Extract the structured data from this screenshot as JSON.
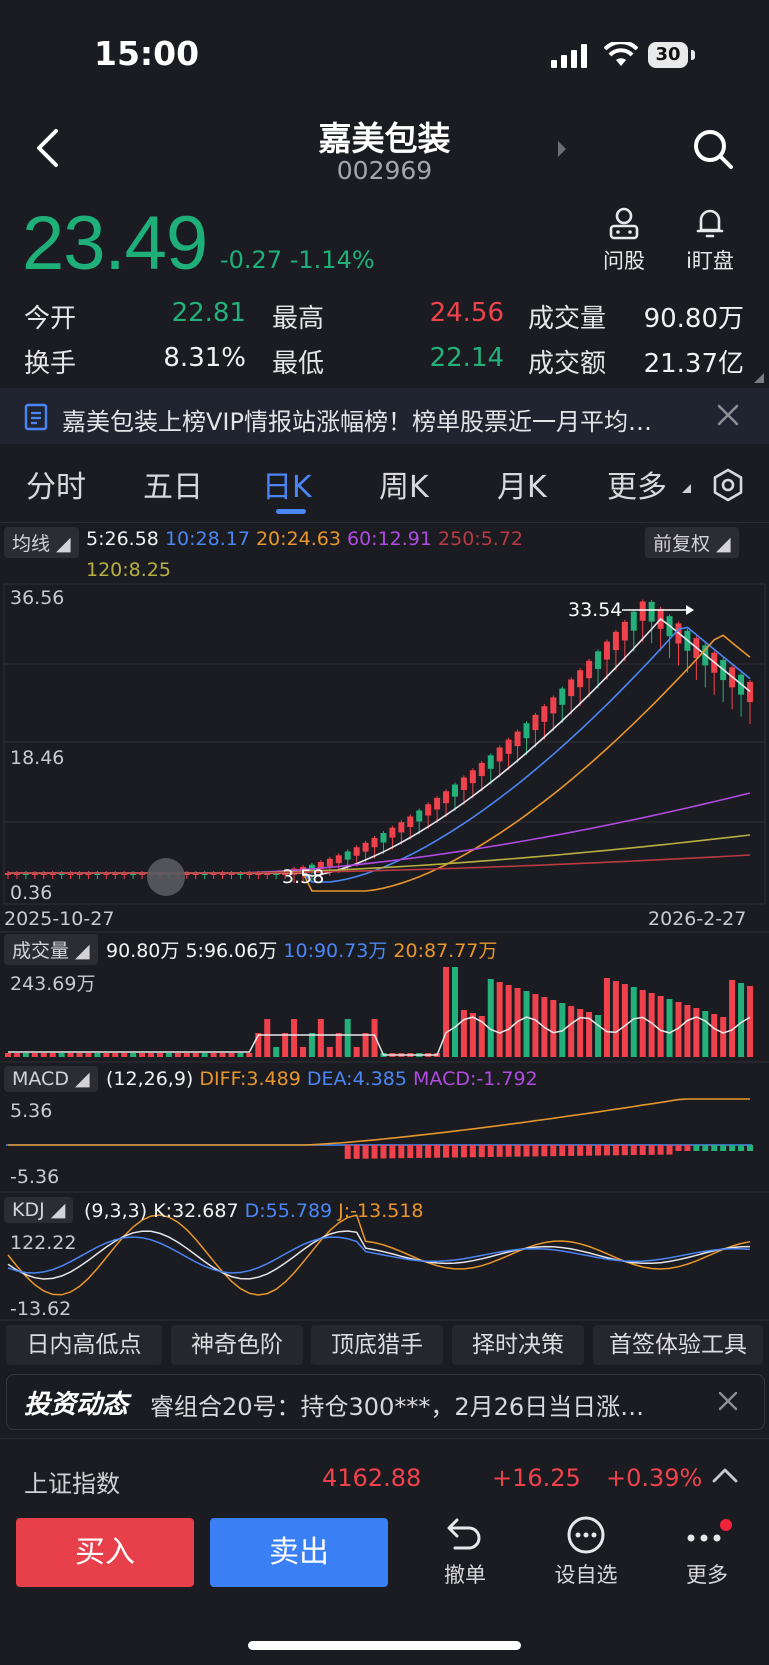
{
  "status_bar": {
    "time": "15:00",
    "battery": "30"
  },
  "header": {
    "name": "嘉美包装",
    "code": "002969",
    "ask_label": "问股",
    "watch_label": "i盯盘"
  },
  "quote": {
    "price": "23.49",
    "change": "-0.27",
    "change_pct": "-1.14%",
    "stats": [
      {
        "label": "今开",
        "value": "22.81",
        "color": "#23b07a"
      },
      {
        "label": "最高",
        "value": "24.56",
        "color": "#f0424d"
      },
      {
        "label": "成交量",
        "value": "90.80万",
        "color": "#f2f2f4"
      },
      {
        "label": "换手",
        "value": "8.31%",
        "color": "#f2f2f4"
      },
      {
        "label": "最低",
        "value": "22.14",
        "color": "#23b07a"
      },
      {
        "label": "成交额",
        "value": "21.37亿",
        "color": "#f2f2f4"
      }
    ]
  },
  "notice": {
    "text": "嘉美包装上榜VIP情报站涨幅榜！榜单股票近一月平均…"
  },
  "tabs": [
    "分时",
    "五日",
    "日K",
    "周K",
    "月K",
    "更多"
  ],
  "active_tab": "日K",
  "ma": {
    "chip": "均线",
    "fq": "前复权",
    "ma5": "5:26.58",
    "ma10": "10:28.17",
    "ma20": "20:24.63",
    "ma60": "60:12.91",
    "ma250": "250:5.72",
    "ma120": "120:8.25"
  },
  "colors": {
    "up": "#f0424d",
    "down": "#23b07a",
    "ma5": "#e6e6ea",
    "ma10": "#4a86f5",
    "ma20": "#e8962b",
    "ma60": "#b04ae0",
    "ma120": "#b7b040",
    "ma250": "#b93a43"
  },
  "kline": {
    "y_max": "36.56",
    "y_mid": "18.46",
    "y_min": "0.36",
    "high_mark": "33.54",
    "low_mark": "3.58",
    "date_start": "2025-10-27",
    "date_end": "2026-2-27"
  },
  "volume": {
    "chip": "成交量",
    "total": "90.80万",
    "v5": "5:96.06万",
    "v10": "10:90.73万",
    "v20": "20:87.77万",
    "max": "243.69万"
  },
  "macd": {
    "chip": "MACD",
    "params": "(12,26,9)",
    "diff": "DIFF:3.489",
    "dea": "DEA:4.385",
    "macd": "MACD:-1.792",
    "top": "5.36",
    "bottom": "-5.36"
  },
  "kdj": {
    "chip": "KDJ",
    "params": "(9,3,3)",
    "k": "K:32.687",
    "d": "D:55.789",
    "j": "J:-13.518",
    "top": "122.22",
    "bottom": "-13.62"
  },
  "tools": [
    "日内高低点",
    "神奇色阶",
    "顶底猎手",
    "择时决策",
    "首签体验工具"
  ],
  "news": {
    "brand": "投资动态",
    "text": "睿组合20号：持仓300***，2月26日当日涨…"
  },
  "index": {
    "name": "上证指数",
    "value": "4162.88",
    "change": "+16.25",
    "pct": "+0.39%"
  },
  "actions": {
    "buy": "买入",
    "sell": "卖出",
    "cancel": "撤单",
    "favorite": "设自选",
    "more": "更多"
  }
}
